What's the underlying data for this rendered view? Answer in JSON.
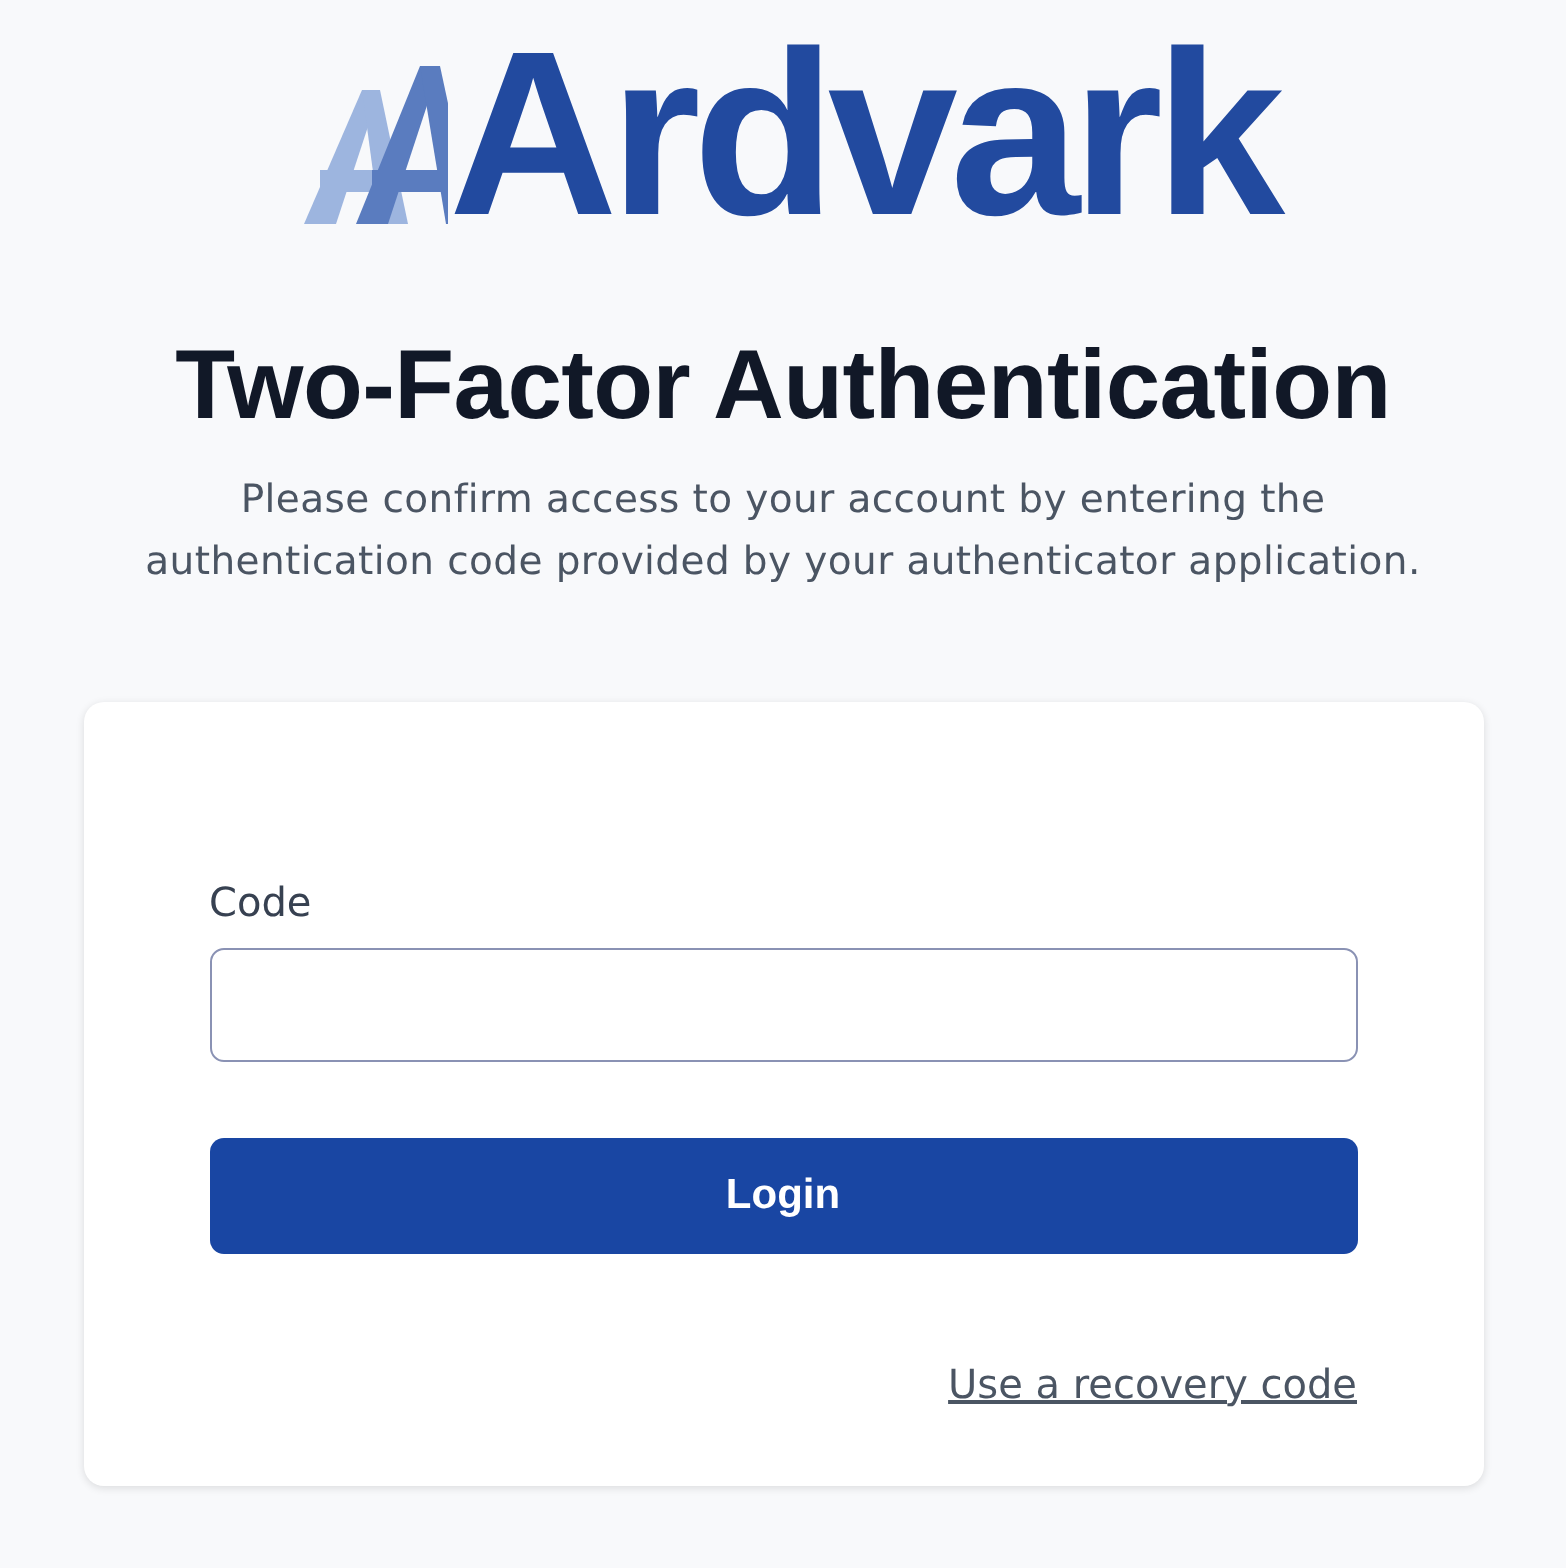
{
  "logo": {
    "text": "Ardvark"
  },
  "heading": "Two-Factor Authentication",
  "description": "Please confirm access to your account by entering the authentication code provided by your authenticator application.",
  "form": {
    "field": {
      "label": "Code"
    },
    "submit": {
      "label": "Login"
    },
    "link": {
      "label": "Use a recovery code"
    }
  }
}
